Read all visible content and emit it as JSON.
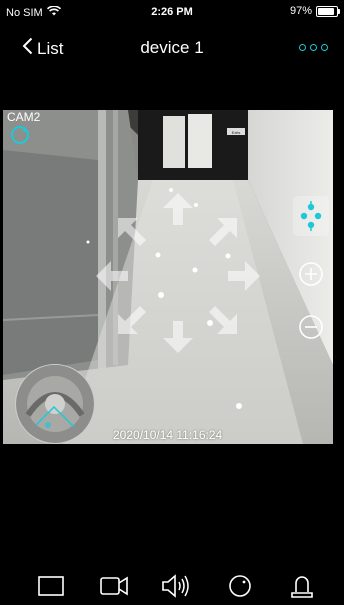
{
  "status": {
    "carrier": "No SIM",
    "time": "2:26 PM",
    "battery_pct": "97%",
    "battery_level": 0.97
  },
  "nav": {
    "back_label": "List",
    "title": "device 1",
    "more_icon": "more-icon"
  },
  "video": {
    "camera_label": "CAM2",
    "timestamp": "2020/10/14 11:16:24",
    "door_sign": "Exits"
  },
  "ptz": {
    "arrows": [
      "up-left",
      "up",
      "up-right",
      "left",
      "right",
      "down-left",
      "down",
      "down-right"
    ],
    "zoom_in_icon": "zoom-in-icon",
    "zoom_out_icon": "zoom-out-icon",
    "ptz_mode_icon": "ptz-joystick-icon"
  },
  "toolbar": {
    "items": [
      "fullscreen-icon",
      "record-video-icon",
      "audio-icon",
      "snapshot-icon",
      "talk-icon"
    ]
  },
  "colors": {
    "accent": "#1ec8d8",
    "background": "#000000"
  }
}
